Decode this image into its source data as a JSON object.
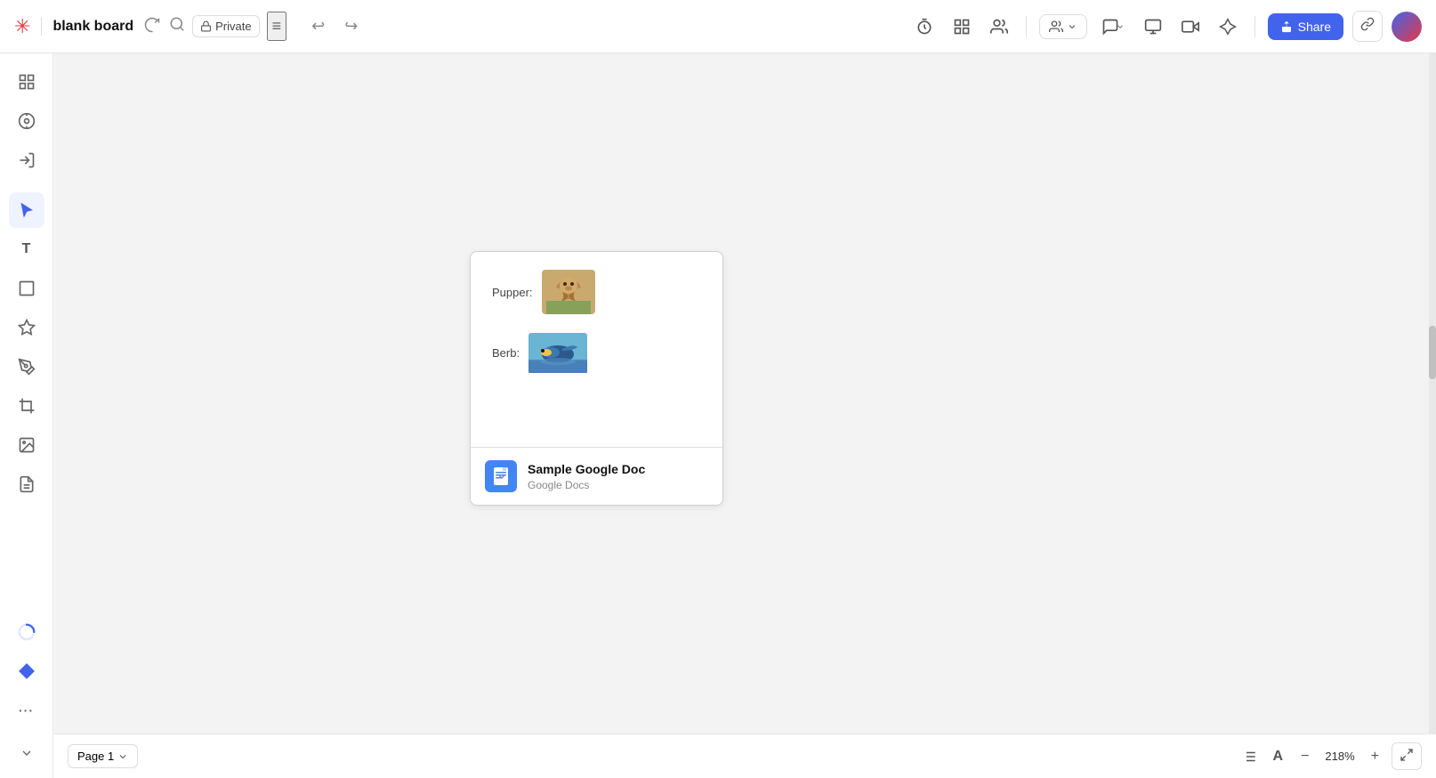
{
  "topbar": {
    "logo": "✳",
    "board_title": "blank board",
    "privacy_label": "Private",
    "undo_icon": "↩",
    "redo_icon": "↪",
    "share_label": "Share",
    "team_icon": "👥"
  },
  "sidebar": {
    "items": [
      {
        "id": "grid-icon",
        "label": "Grid",
        "icon": "⊞",
        "active": false
      },
      {
        "id": "target-icon",
        "label": "Target",
        "icon": "◎",
        "active": false
      },
      {
        "id": "sign-in-icon",
        "label": "Sign In",
        "icon": "⬡",
        "active": false
      },
      {
        "id": "cursor-icon",
        "label": "Cursor",
        "icon": "▷",
        "active": true
      },
      {
        "id": "text-icon",
        "label": "Text",
        "icon": "T",
        "active": false
      },
      {
        "id": "frame-icon",
        "label": "Frame",
        "icon": "▭",
        "active": false
      },
      {
        "id": "shapes-icon",
        "label": "Shapes",
        "icon": "⬠",
        "active": false
      },
      {
        "id": "pen-icon",
        "label": "Pen",
        "icon": "✒",
        "active": false
      },
      {
        "id": "crop-icon",
        "label": "Crop",
        "icon": "⊡",
        "active": false
      },
      {
        "id": "image-icon",
        "label": "Image",
        "icon": "🖼",
        "active": false
      },
      {
        "id": "sticky-icon",
        "label": "Sticky",
        "icon": "⌗",
        "active": false
      },
      {
        "id": "loading-icon",
        "label": "Loading",
        "icon": "◌",
        "active": false
      },
      {
        "id": "diamond-icon",
        "label": "Diamond",
        "icon": "◆",
        "active": false
      },
      {
        "id": "more-icon",
        "label": "More",
        "icon": "•••",
        "active": false
      }
    ]
  },
  "canvas": {
    "card": {
      "top": {
        "pupper_label": "Pupper:",
        "berb_label": "Berb:"
      },
      "bottom": {
        "doc_title": "Sample Google Doc",
        "doc_subtitle": "Google Docs"
      }
    }
  },
  "bottombar": {
    "page_label": "Page 1",
    "zoom_level": "218%",
    "zoom_in_icon": "+",
    "zoom_out_icon": "−",
    "fit_icon": "⤢"
  }
}
